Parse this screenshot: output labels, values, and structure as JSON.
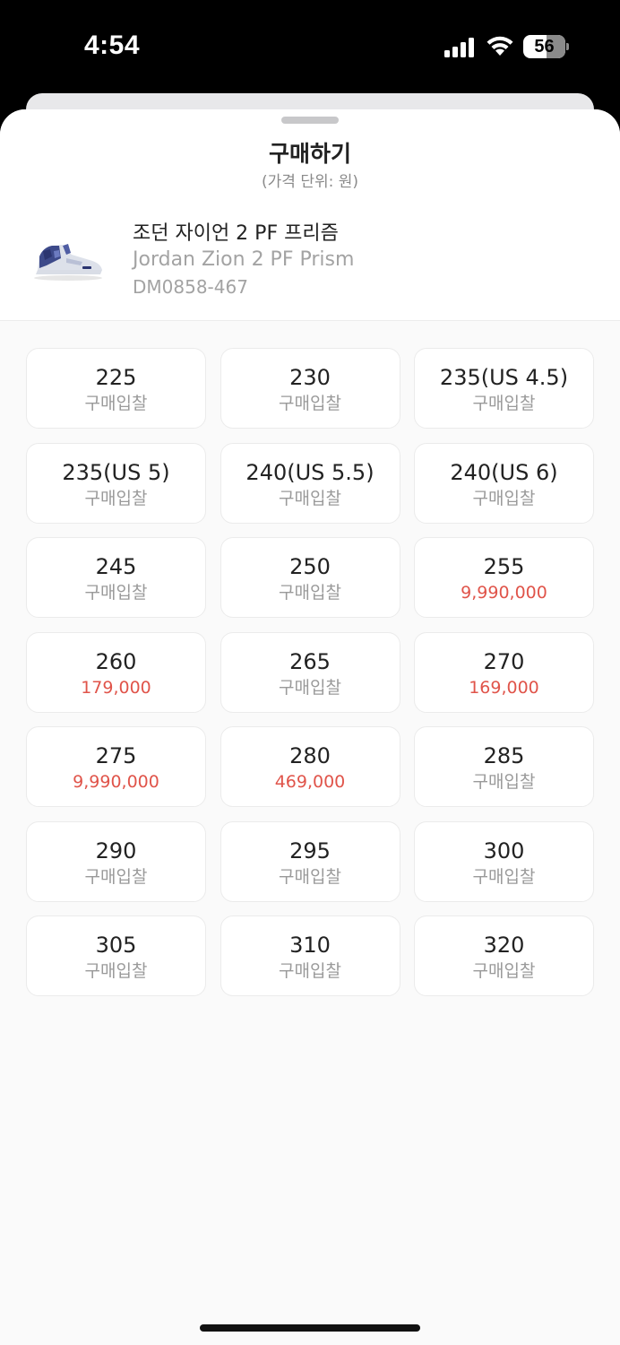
{
  "status_bar": {
    "time": "4:54",
    "battery": "56",
    "signal_icon": "cellular-signal-icon",
    "wifi_icon": "wifi-icon",
    "battery_icon": "battery-icon"
  },
  "sheet": {
    "title": "구매하기",
    "subtitle": "(가격 단위: 원)"
  },
  "product": {
    "image_icon": "sneaker-image",
    "name_ko": "조던 자이언 2 PF 프리즘",
    "name_en": "Jordan Zion 2 PF Prism",
    "code": "DM0858-467"
  },
  "accent_color": "#e0544a",
  "sizes": [
    {
      "size": "225",
      "price": "구매입찰",
      "has_price": false
    },
    {
      "size": "230",
      "price": "구매입찰",
      "has_price": false
    },
    {
      "size": "235(US 4.5)",
      "price": "구매입찰",
      "has_price": false
    },
    {
      "size": "235(US 5)",
      "price": "구매입찰",
      "has_price": false
    },
    {
      "size": "240(US 5.5)",
      "price": "구매입찰",
      "has_price": false
    },
    {
      "size": "240(US 6)",
      "price": "구매입찰",
      "has_price": false
    },
    {
      "size": "245",
      "price": "구매입찰",
      "has_price": false
    },
    {
      "size": "250",
      "price": "구매입찰",
      "has_price": false
    },
    {
      "size": "255",
      "price": "9,990,000",
      "has_price": true
    },
    {
      "size": "260",
      "price": "179,000",
      "has_price": true
    },
    {
      "size": "265",
      "price": "구매입찰",
      "has_price": false
    },
    {
      "size": "270",
      "price": "169,000",
      "has_price": true
    },
    {
      "size": "275",
      "price": "9,990,000",
      "has_price": true
    },
    {
      "size": "280",
      "price": "469,000",
      "has_price": true
    },
    {
      "size": "285",
      "price": "구매입찰",
      "has_price": false
    },
    {
      "size": "290",
      "price": "구매입찰",
      "has_price": false
    },
    {
      "size": "295",
      "price": "구매입찰",
      "has_price": false
    },
    {
      "size": "300",
      "price": "구매입찰",
      "has_price": false
    },
    {
      "size": "305",
      "price": "구매입찰",
      "has_price": false
    },
    {
      "size": "310",
      "price": "구매입찰",
      "has_price": false
    },
    {
      "size": "320",
      "price": "구매입찰",
      "has_price": false
    }
  ]
}
